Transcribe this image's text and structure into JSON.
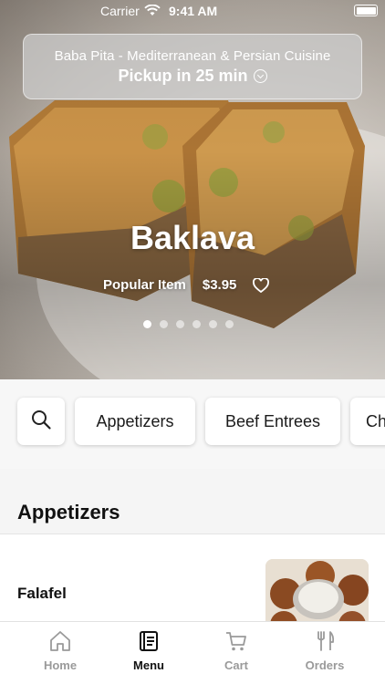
{
  "status_bar": {
    "carrier": "Carrier",
    "time": "9:41 AM"
  },
  "restaurant": {
    "name": "Baba Pita - Mediterranean & Persian Cuisine",
    "pickup": "Pickup in 25 min"
  },
  "featured": {
    "title": "Baklava",
    "tag": "Popular Item",
    "price": "$3.95",
    "carousel_count": 6,
    "carousel_active": 0
  },
  "categories": {
    "items": [
      "Appetizers",
      "Beef Entrees",
      "Ch"
    ]
  },
  "section": {
    "title": "Appetizers"
  },
  "menu_items": [
    {
      "name": "Falafel"
    }
  ],
  "tabbar": {
    "items": [
      {
        "label": "Home",
        "icon": "home-icon",
        "active": false
      },
      {
        "label": "Menu",
        "icon": "menu-book-icon",
        "active": true
      },
      {
        "label": "Cart",
        "icon": "cart-icon",
        "active": false
      },
      {
        "label": "Orders",
        "icon": "fork-knife-icon",
        "active": false
      }
    ]
  },
  "colors": {
    "active_tab": "#111111",
    "inactive_tab": "#9a9a9a",
    "chip_bg": "#ffffff"
  }
}
